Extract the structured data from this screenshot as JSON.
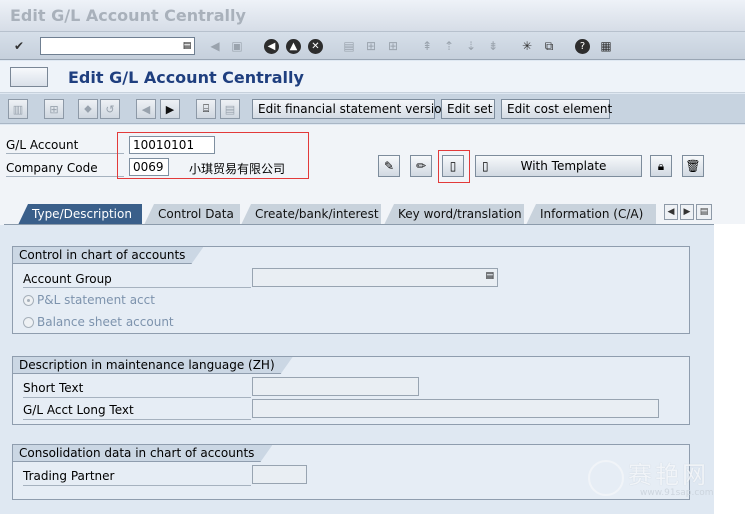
{
  "window": {
    "title": "Edit G/L Account Centrally"
  },
  "app": {
    "title": "Edit G/L Account Centrally"
  },
  "toolbar": {
    "btn_fin_stmt": "Edit financial statement version",
    "btn_edit_set": "Edit set",
    "btn_cost_element": "Edit cost element"
  },
  "header": {
    "gl_account_label": "G/L Account",
    "gl_account_value": "10010101",
    "company_code_label": "Company Code",
    "company_code_value": "0069",
    "company_name": "小琪贸易有限公司",
    "with_template_label": "With Template"
  },
  "tabs": [
    {
      "label": "Type/Description"
    },
    {
      "label": "Control Data"
    },
    {
      "label": "Create/bank/interest"
    },
    {
      "label": "Key word/translation"
    },
    {
      "label": "Information (C/A)"
    }
  ],
  "group_control": {
    "title": "Control in chart of accounts",
    "account_group_label": "Account Group",
    "pl_label": "P&L statement acct",
    "bs_label": "Balance sheet account"
  },
  "group_description": {
    "title": "Description in maintenance language (ZH)",
    "short_text_label": "Short Text",
    "long_text_label": "G/L Acct Long Text"
  },
  "group_consolidation": {
    "title": "Consolidation data in chart of accounts",
    "trading_partner_label": "Trading Partner"
  },
  "watermark": {
    "text": "赛艳网",
    "url": "www.91sap.com"
  }
}
